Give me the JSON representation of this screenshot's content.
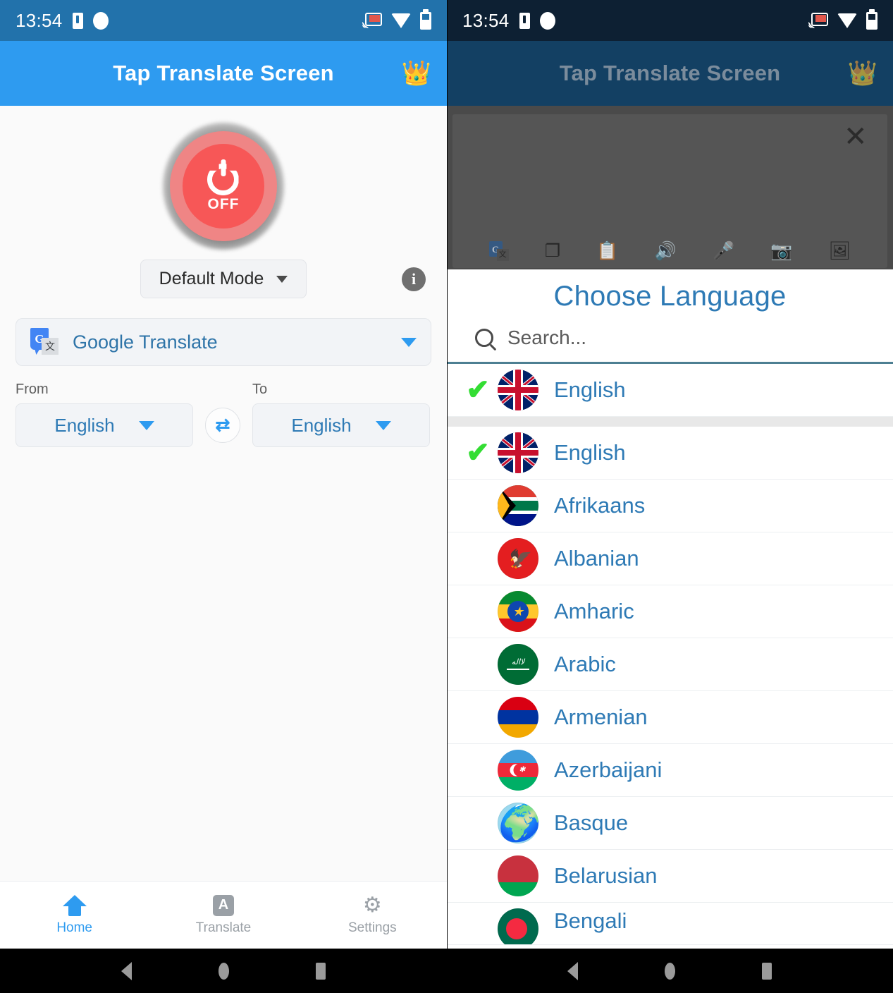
{
  "status_bar": {
    "time": "13:54",
    "icons": [
      "sim-card-icon",
      "circle-dot-icon",
      "cast-icon",
      "wifi-icon",
      "battery-icon"
    ]
  },
  "left_panel": {
    "app_bar": {
      "title": "Tap Translate Screen",
      "premium_icon": "crown-icon",
      "crown_glyph": "👑"
    },
    "power_button": {
      "state_label": "OFF",
      "icon": "power-icon",
      "color": "#f75757"
    },
    "mode_selector": {
      "value": "Default Mode",
      "caret_icon": "chevron-down-icon"
    },
    "info_button": {
      "label": "i",
      "icon": "info-icon"
    },
    "engine_selector": {
      "icon": "google-translate-icon",
      "icon_letter": "G",
      "icon_sub": "文",
      "value": "Google Translate",
      "caret_icon": "chevron-down-icon"
    },
    "from_to": {
      "from_label": "From",
      "from_value": "English",
      "to_label": "To",
      "to_value": "English",
      "swap_icon": "swap-arrows-icon",
      "swap_glyph": "⇄"
    },
    "bottom_nav": [
      {
        "label": "Home",
        "icon": "home-icon",
        "active": true
      },
      {
        "label": "Translate",
        "icon": "translate-a-icon",
        "active": false,
        "letter": "A"
      },
      {
        "label": "Settings",
        "icon": "gear-icon",
        "active": false,
        "glyph": "⚙"
      }
    ]
  },
  "right_panel": {
    "app_bar": {
      "title": "Tap Translate Screen",
      "premium_icon": "crown-icon",
      "crown_glyph": "👑"
    },
    "overlay_card": {
      "close_icon": "close-icon",
      "close_glyph": "✕",
      "tools": [
        {
          "name": "google-translate-icon",
          "letter": "G",
          "sub": "文"
        },
        {
          "name": "copy-icon",
          "glyph": "❐"
        },
        {
          "name": "clipboard-text-icon",
          "glyph": "📋"
        },
        {
          "name": "speaker-icon",
          "glyph": "🔊"
        },
        {
          "name": "microphone-icon",
          "glyph": "🎤"
        },
        {
          "name": "camera-icon",
          "glyph": "📷"
        },
        {
          "name": "gallery-icon",
          "glyph": "🖼"
        }
      ]
    },
    "chooser": {
      "title": "Choose Language",
      "search_placeholder": "Search...",
      "search_value": "",
      "search_icon": "search-icon",
      "check_glyph": "✔",
      "selected_language": "English",
      "pinned": {
        "name": "English",
        "flag": "f-uk",
        "checked": true
      },
      "languages": [
        {
          "name": "English",
          "flag": "f-uk",
          "checked": true
        },
        {
          "name": "Afrikaans",
          "flag": "f-za",
          "checked": false
        },
        {
          "name": "Albanian",
          "flag": "f-al",
          "checked": false
        },
        {
          "name": "Amharic",
          "flag": "f-et",
          "checked": false
        },
        {
          "name": "Arabic",
          "flag": "f-sa",
          "checked": false
        },
        {
          "name": "Armenian",
          "flag": "f-am",
          "checked": false
        },
        {
          "name": "Azerbaijani",
          "flag": "f-az",
          "checked": false
        },
        {
          "name": "Basque",
          "flag": "f-globe",
          "checked": false
        },
        {
          "name": "Belarusian",
          "flag": "f-by",
          "checked": false
        },
        {
          "name": "Bengali",
          "flag": "f-bd",
          "checked": false
        }
      ]
    }
  },
  "android_nav": {
    "buttons": [
      "back-button",
      "home-button",
      "recents-button"
    ]
  },
  "colors": {
    "left_status_bar": "#2272ab",
    "left_app_bar": "#2e9bf0",
    "right_status_bar": "#0d2033",
    "right_app_bar": "#134063",
    "accent_blue": "#2e7ab5",
    "power_off_red": "#f75757",
    "check_green": "#33dd33",
    "overlay_dim": "#4a4a4a"
  }
}
